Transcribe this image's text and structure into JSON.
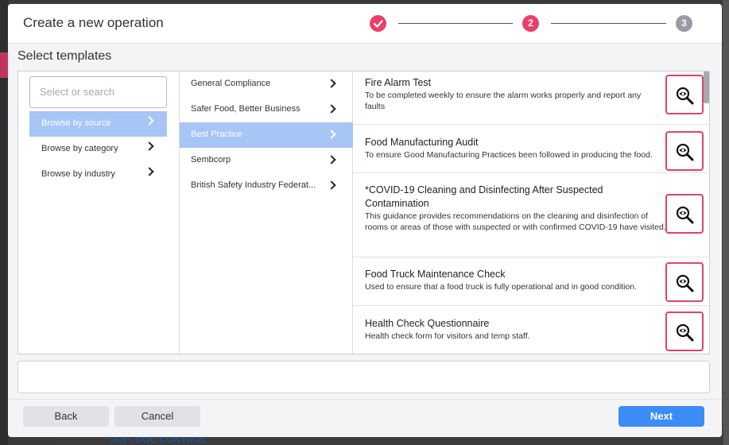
{
  "modal": {
    "title": "Create a new operation",
    "steps": [
      {
        "label": "✓",
        "state": "complete"
      },
      {
        "label": "2",
        "state": "current"
      },
      {
        "label": "3",
        "state": "upcoming"
      }
    ]
  },
  "section_title": "Select templates",
  "browse": {
    "search_placeholder": "Select or search",
    "items": [
      {
        "label": "Browse by source",
        "active": true
      },
      {
        "label": "Browse by category",
        "active": false
      },
      {
        "label": "Browse by industry",
        "active": false
      }
    ]
  },
  "sources": [
    {
      "label": "General Compliance",
      "active": false
    },
    {
      "label": "Safer Food, Better Business",
      "active": false
    },
    {
      "label": "Best Practice",
      "active": true
    },
    {
      "label": "Sembcorp",
      "active": false
    },
    {
      "label": "British Safety Industry Federat...",
      "active": false
    }
  ],
  "templates": [
    {
      "title": "Fire Alarm Test",
      "description": "To be completed weekly to ensure the alarm works properly and report any faults"
    },
    {
      "title": "Food Manufacturing Audit",
      "description": "To ensure Good Manufacturing Practices been followed in producing the food."
    },
    {
      "title": "*COVID-19 Cleaning and Disinfecting After Suspected Contamination",
      "description": "This guidance provides recommendations on the cleaning and disinfection of rooms or areas of those with suspected or with confirmed COVID-19 have visited."
    },
    {
      "title": "Food Truck Maintenance Check",
      "description": "Used to ensure that a food truck is fully operational and in good condition."
    },
    {
      "title": "Health Check Questionnaire",
      "description": "Health check form for visitors and temp staff."
    }
  ],
  "footer": {
    "back_label": "Back",
    "cancel_label": "Cancel",
    "next_label": "Next"
  },
  "background": {
    "bottom_text": "SOP- DOC CONTROL"
  },
  "colors": {
    "accent_pink": "#e8406b",
    "selection_blue": "#a7c5f5",
    "primary_blue": "#3b8cf6",
    "step_inactive": "#999aa2"
  },
  "icons": {
    "step_complete": "checkmark-icon",
    "preview": "preview-eye-magnifier-icon",
    "chevron": "chevron-right-icon"
  }
}
